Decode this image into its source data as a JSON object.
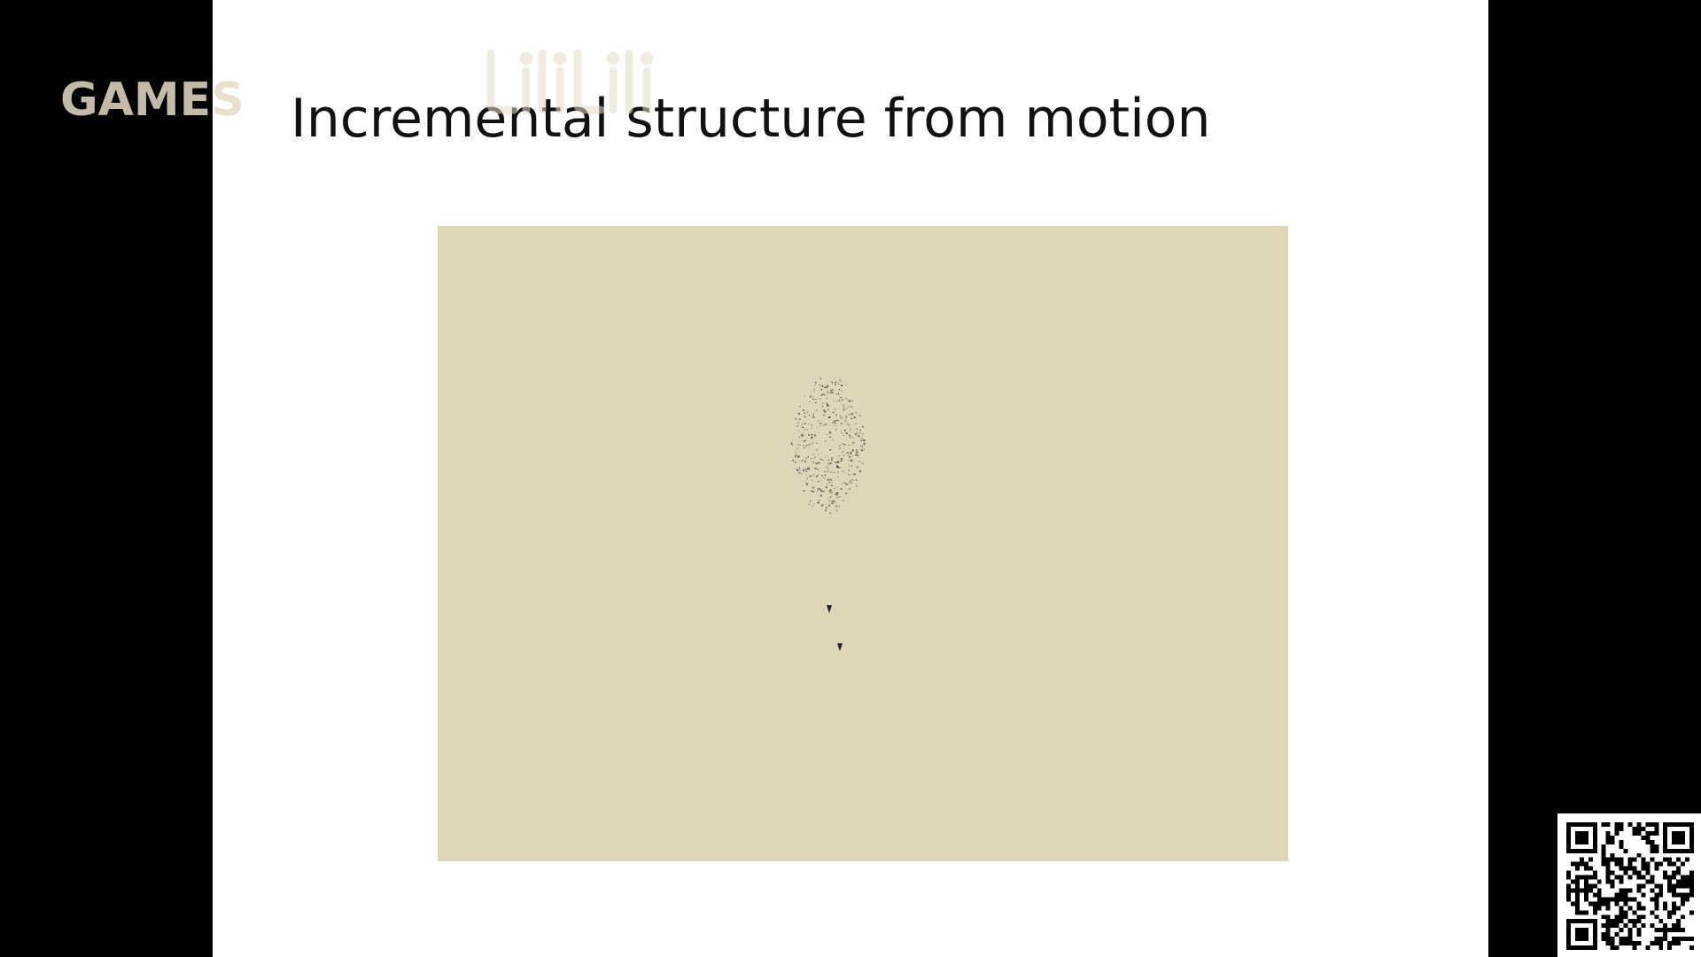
{
  "slide": {
    "title": "Incremental structure from motion"
  },
  "watermark": {
    "channel_text": "GAMES",
    "platform_logo_icon": "bilibili-logo-icon",
    "text_color": "#e6dcc6"
  },
  "figure": {
    "content": "sparse-3d-point-cloud-render",
    "background_color": "#dfd5b9",
    "point_color": "#3a3a40"
  },
  "qr_code": {
    "icon": "qr-code-icon"
  },
  "colors": {
    "page_background": "#000000",
    "slide_background": "#ffffff",
    "title_color": "#111111"
  }
}
